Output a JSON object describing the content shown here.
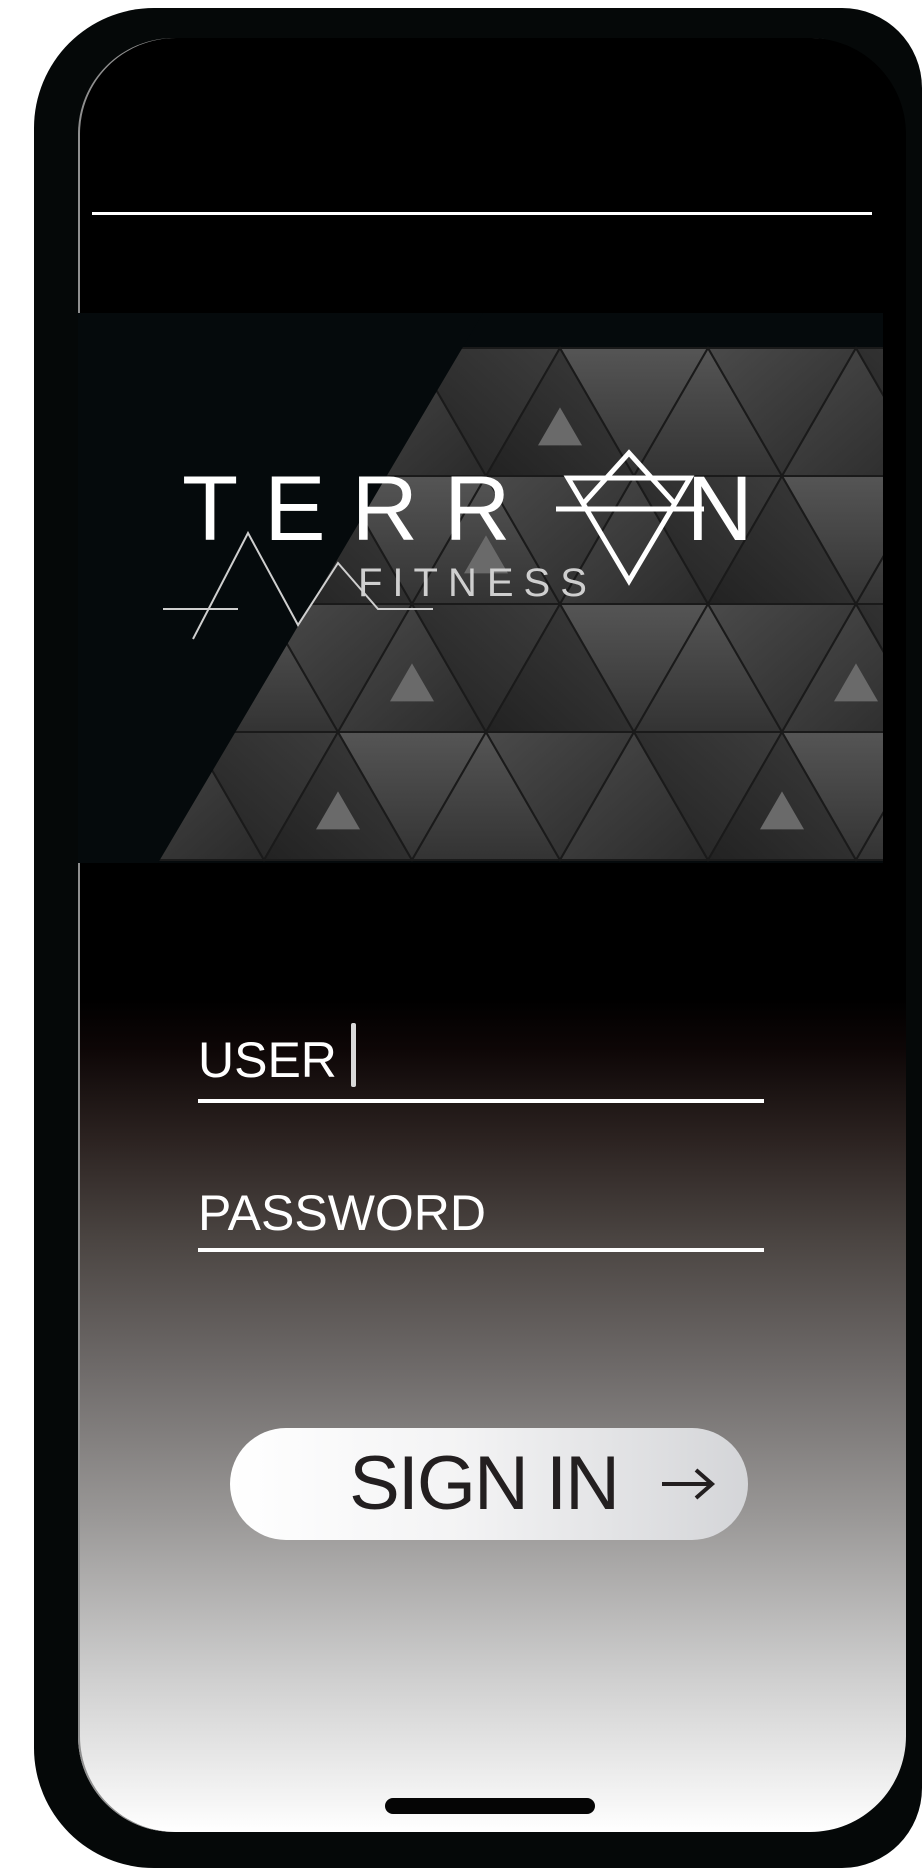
{
  "brand": {
    "name": "TERRAN",
    "name_prefix": "TERR",
    "name_suffix": "N",
    "tagline": "FITNESS"
  },
  "login": {
    "user_label": "USER",
    "password_label": "PASSWORD",
    "sign_in_label": "SIGN IN"
  },
  "icons": {
    "arrow": "arrow-right-icon",
    "logo_mark": "triangle-logo-icon"
  },
  "colors": {
    "frame": "#050808",
    "screen_top": "#000000",
    "screen_bottom": "#ffffff",
    "button_text": "#231f20",
    "text": "#ffffff"
  }
}
